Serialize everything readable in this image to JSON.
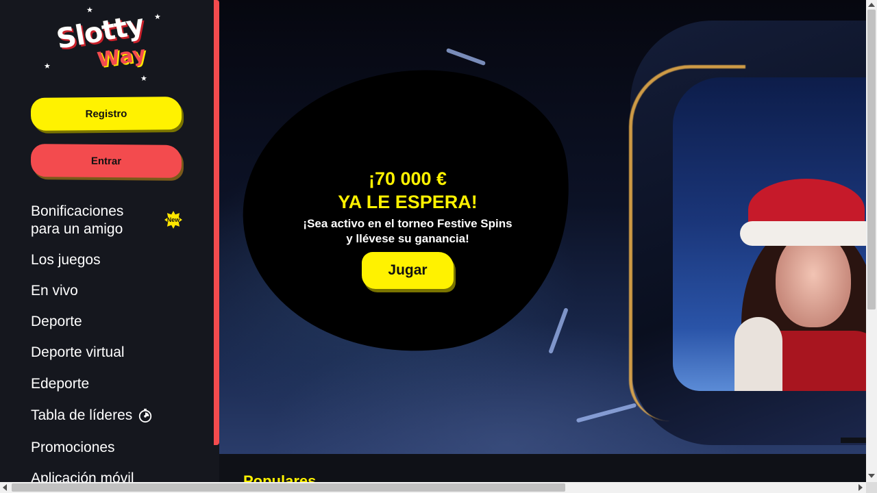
{
  "brand": {
    "logo_line1": "Slotty",
    "logo_line2": "Way"
  },
  "sidebar": {
    "register_label": "Registro",
    "login_label": "Entrar",
    "items": [
      {
        "label_line1": "Bonificaciones",
        "label_line2": "para un amigo",
        "badge": "New"
      },
      {
        "label": "Los juegos"
      },
      {
        "label": "En vivo"
      },
      {
        "label": "Deporte"
      },
      {
        "label": "Deporte virtual"
      },
      {
        "label": "Edeporte"
      },
      {
        "label": "Tabla de líderes",
        "icon": "timer-icon"
      },
      {
        "label": "Promociones"
      },
      {
        "label": "Aplicación móvil"
      }
    ]
  },
  "hero": {
    "title_line1": "¡70 000 €",
    "title_line2": "YA LE ESPERA!",
    "subtitle_line1": "¡Sea activo en el torneo Festive Spins",
    "subtitle_line2": "y llévese su ganancia!",
    "play_label": "Jugar"
  },
  "main": {
    "section_title": "Populares"
  },
  "colors": {
    "accent_yellow": "#fff200",
    "accent_red": "#f34b4e",
    "sidebar_bg": "#15171e"
  }
}
